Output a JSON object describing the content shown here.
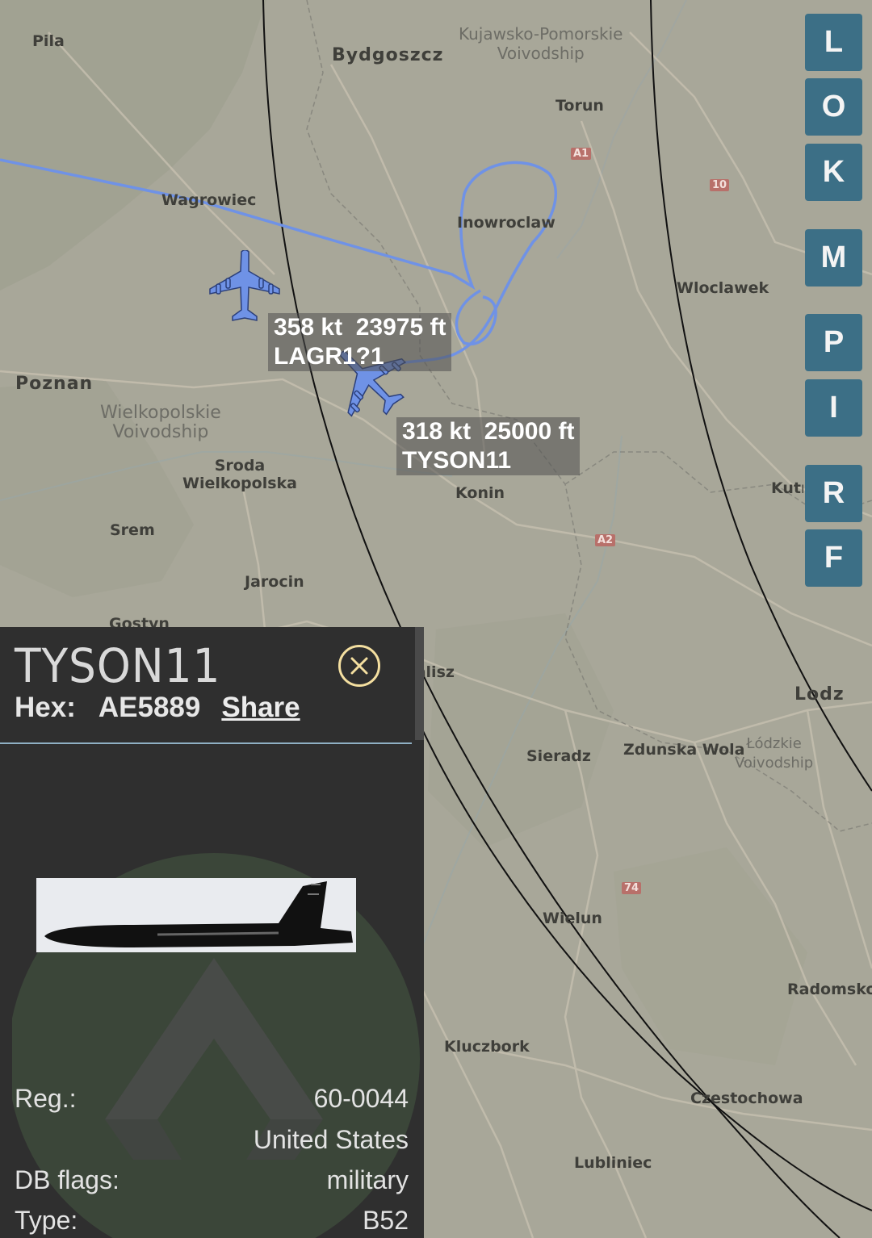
{
  "map": {
    "places": [
      {
        "id": "pila",
        "name": "Pila"
      },
      {
        "id": "bydgoszcz",
        "name": "Bydgoszcz"
      },
      {
        "id": "torun",
        "name": "Torun"
      },
      {
        "id": "wagrowiec",
        "name": "Wagrowiec"
      },
      {
        "id": "inowroclaw",
        "name": "Inowroclaw"
      },
      {
        "id": "wloclawek",
        "name": "Wloclawek"
      },
      {
        "id": "poznan",
        "name": "Poznan"
      },
      {
        "id": "sroda",
        "name": "Sroda\nWielkopolska"
      },
      {
        "id": "srem",
        "name": "Srem"
      },
      {
        "id": "konin",
        "name": "Konin"
      },
      {
        "id": "kutno",
        "name": "Kutno"
      },
      {
        "id": "jarocin",
        "name": "Jarocin"
      },
      {
        "id": "gostyn",
        "name": "Gostyn"
      },
      {
        "id": "kalisz",
        "name": "Kalisz"
      },
      {
        "id": "lodz",
        "name": "Lodz"
      },
      {
        "id": "sieradz",
        "name": "Sieradz"
      },
      {
        "id": "zdunska",
        "name": "Zdunska Wola"
      },
      {
        "id": "wielun",
        "name": "Wielun"
      },
      {
        "id": "radomsko",
        "name": "Radomsko"
      },
      {
        "id": "kluczbork",
        "name": "Kluczbork"
      },
      {
        "id": "czestochowa",
        "name": "Czestochowa"
      },
      {
        "id": "lubliniec",
        "name": "Lubliniec"
      }
    ],
    "regions": [
      {
        "id": "kujawsko",
        "name": "Kujawsko-Pomorskie\nVoivodship"
      },
      {
        "id": "wielkopolskie",
        "name": "Wielkopolskie\nVoivodship"
      },
      {
        "id": "lodzkie",
        "name": "Łódzkie\nVoivodship"
      }
    ],
    "roads": [
      {
        "id": "a1",
        "label": "A1"
      },
      {
        "id": "r10",
        "label": "10"
      },
      {
        "id": "a2",
        "label": "A2"
      },
      {
        "id": "r74",
        "label": "74"
      }
    ]
  },
  "aircraft": [
    {
      "id": "lagr",
      "label": "358 kt  23975 ft\nLAGR1?1",
      "color": "#6f92e6"
    },
    {
      "id": "tyson",
      "label": "318 kt  25000 ft\nTYSON11",
      "color": "#6f92e6"
    }
  ],
  "map_buttons": [
    "L",
    "O",
    "K",
    "M",
    "P",
    "I",
    "R",
    "F"
  ],
  "panel": {
    "callsign": "TYSON11",
    "hex_label": "Hex:",
    "hex": "AE5889",
    "share": "Share",
    "rows": [
      {
        "label": "Reg.:",
        "value": "60-0044"
      },
      {
        "label": "",
        "value": "United States"
      },
      {
        "label": "DB flags:",
        "value": "military"
      },
      {
        "label": "Type:",
        "value": "B52"
      }
    ]
  },
  "colors": {
    "track": "#6f92e6",
    "button": "#3c6f86",
    "panel_bg": "#2f2f2f",
    "close_icon": "#f4dfa0"
  }
}
